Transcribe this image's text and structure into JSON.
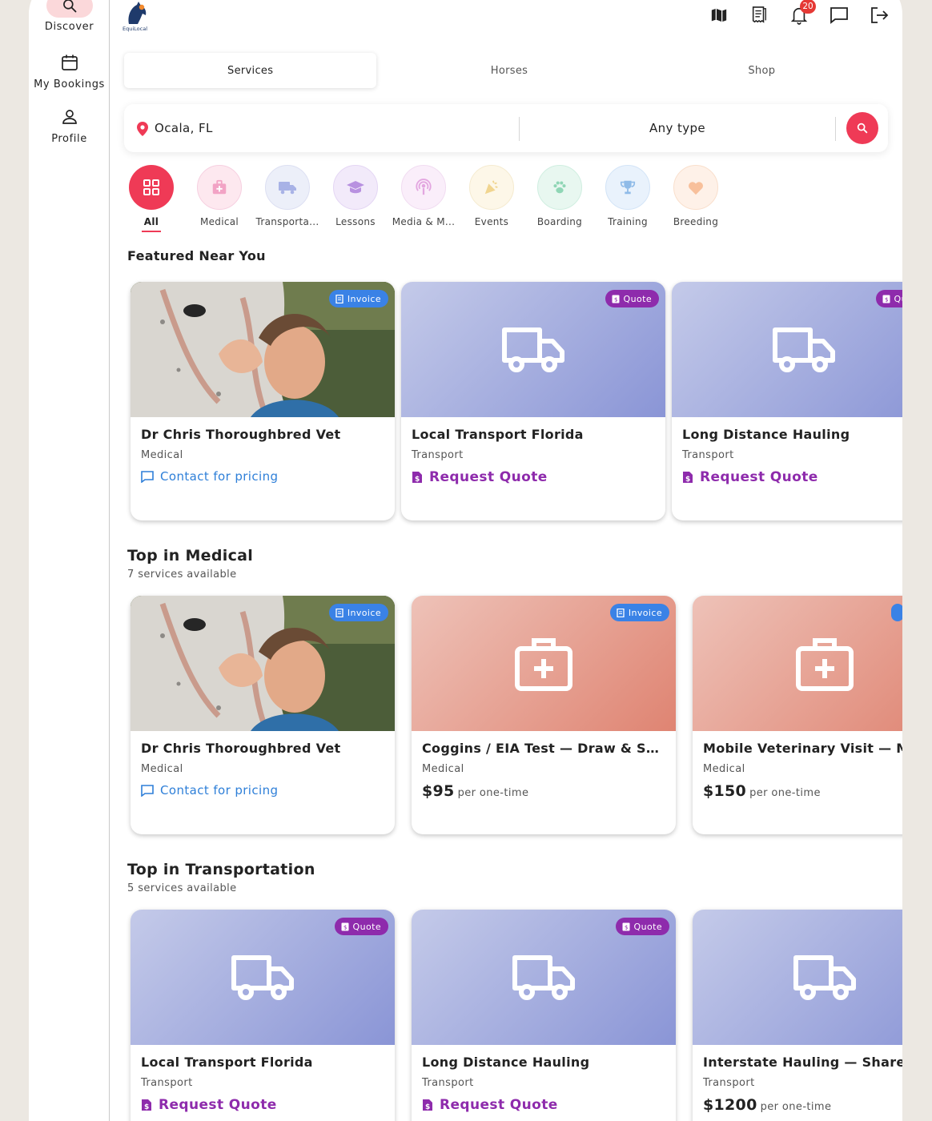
{
  "rail": {
    "discover": "Discover",
    "bookings": "My Bookings",
    "profile": "Profile"
  },
  "logo_text": "EquiLocal",
  "topbar": {
    "notif_count": "20"
  },
  "tabs": [
    "Services",
    "Horses",
    "Shop"
  ],
  "search": {
    "location": "Ocala, FL",
    "type": "Any type"
  },
  "categories": [
    "All",
    "Medical",
    "Transporta...",
    "Lessons",
    "Media & M...",
    "Events",
    "Boarding",
    "Training",
    "Breeding"
  ],
  "sections": {
    "featured": {
      "title": "Featured Near You",
      "cards": [
        {
          "title": "Dr Chris Thoroughbred Vet",
          "category": "Medical",
          "chip": "Invoice",
          "action": "Contact for pricing"
        },
        {
          "title": "Local Transport Florida",
          "category": "Transport",
          "chip": "Quote",
          "action": "Request Quote"
        },
        {
          "title": "Long Distance Hauling",
          "category": "Transport",
          "chip": "Quote",
          "action": "Request Quote"
        }
      ]
    },
    "medical": {
      "title": "Top in Medical",
      "subtitle": "7 services available",
      "cards": [
        {
          "title": "Dr Chris Thoroughbred Vet",
          "category": "Medical",
          "chip": "Invoice",
          "action": "Contact for pricing"
        },
        {
          "title": "Coggins / EIA Test — Draw & Submi...",
          "category": "Medical",
          "chip": "Invoice",
          "price": "$95",
          "per": "per one-time"
        },
        {
          "title": "Mobile Veterinary Visit — Mari",
          "category": "Medical",
          "chip": "",
          "price": "$150",
          "per": "per one-time"
        }
      ]
    },
    "transport": {
      "title": "Top in Transportation",
      "subtitle": "5 services available",
      "cards": [
        {
          "title": "Local Transport Florida",
          "category": "Transport",
          "chip": "Quote",
          "action": "Request Quote"
        },
        {
          "title": "Long Distance Hauling",
          "category": "Transport",
          "chip": "Quote",
          "action": "Request Quote"
        },
        {
          "title": "Interstate Hauling — Shared Lo",
          "category": "Transport",
          "chip": "",
          "price": "$1200",
          "per": "per one-time"
        }
      ]
    }
  },
  "colors": {
    "accent": "#ef3a56",
    "quote": "#8e2bac",
    "invoice": "#3a82e6",
    "link": "#2e7fd8"
  }
}
